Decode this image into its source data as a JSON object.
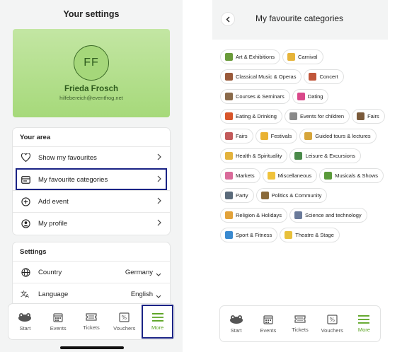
{
  "left": {
    "title": "Your settings",
    "profile": {
      "initials": "FF",
      "name": "Frieda Frosch",
      "email": "hilfebereich@eventfrog.net"
    },
    "area": {
      "title": "Your area",
      "items": [
        {
          "label": "Show my favourites",
          "icon": "heart-icon"
        },
        {
          "label": "My favourite categories",
          "icon": "category-icon"
        },
        {
          "label": "Add event",
          "icon": "plus-circle-icon"
        },
        {
          "label": "My profile",
          "icon": "user-icon"
        }
      ]
    },
    "settings": {
      "title": "Settings",
      "items": [
        {
          "label": "Country",
          "value": "Germany",
          "icon": "globe-icon"
        },
        {
          "label": "Language",
          "value": "English",
          "icon": "language-icon"
        }
      ]
    }
  },
  "right": {
    "title": "My favourite categories",
    "categories": [
      {
        "label": "Art & Exhibitions",
        "color": "#6a9b3a"
      },
      {
        "label": "Carnival",
        "color": "#e6b43a"
      },
      {
        "label": "Classical Music & Operas",
        "color": "#9a5a3a"
      },
      {
        "label": "Concert",
        "color": "#c0563a"
      },
      {
        "label": "Courses & Seminars",
        "color": "#8a6a4a"
      },
      {
        "label": "Dating",
        "color": "#d9488a"
      },
      {
        "label": "Eating & Drinking",
        "color": "#d8552a"
      },
      {
        "label": "Events for children",
        "color": "#8a8a8a"
      },
      {
        "label": "Fairs",
        "color": "#7a5a3a"
      },
      {
        "label": "Fairs",
        "color": "#c25a5a"
      },
      {
        "label": "Festivals",
        "color": "#e9b233"
      },
      {
        "label": "Guided tours & lectures",
        "color": "#d6a53a"
      },
      {
        "label": "Health & Spirituality",
        "color": "#e3b23c"
      },
      {
        "label": "Leisure & Excursions",
        "color": "#4a8a4a"
      },
      {
        "label": "Markets",
        "color": "#d96a9a"
      },
      {
        "label": "Miscellaneous",
        "color": "#f0c23a"
      },
      {
        "label": "Musicals & Shows",
        "color": "#5a9a3a"
      },
      {
        "label": "Party",
        "color": "#5a6a7a"
      },
      {
        "label": "Politics & Community",
        "color": "#8a6a3a"
      },
      {
        "label": "Religion & Holidays",
        "color": "#e2a23a"
      },
      {
        "label": "Science and technology",
        "color": "#6a7a9a"
      },
      {
        "label": "Sport & Fitness",
        "color": "#3a8ad0"
      },
      {
        "label": "Theatre & Stage",
        "color": "#e8c03a"
      }
    ]
  },
  "tabs": [
    {
      "label": "Start",
      "icon": "frog-icon"
    },
    {
      "label": "Events",
      "icon": "calendar-icon"
    },
    {
      "label": "Tickets",
      "icon": "ticket-icon"
    },
    {
      "label": "Vouchers",
      "icon": "voucher-icon"
    },
    {
      "label": "More",
      "icon": "menu-icon",
      "active": true
    }
  ],
  "colors": {
    "accent": "#5aa321",
    "highlight": "#1a2385",
    "profile_bg": "#b3de8c"
  }
}
